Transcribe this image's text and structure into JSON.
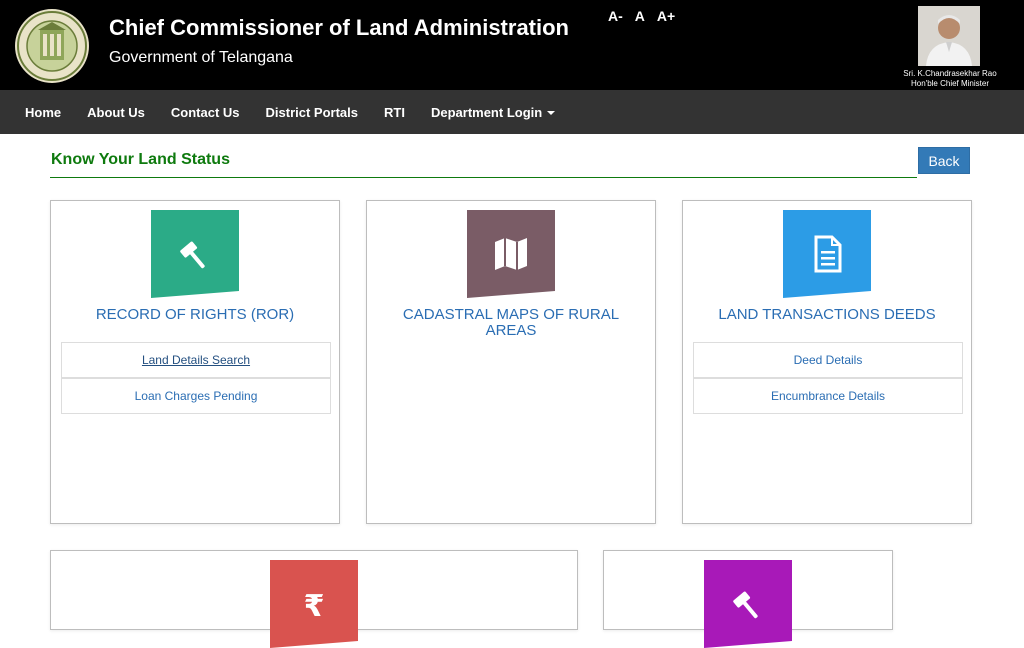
{
  "header": {
    "title": "Chief Commissioner of Land Administration",
    "subtitle": "Government of Telangana",
    "font_controls": [
      "A-",
      "A",
      "A+"
    ],
    "cm_name": "Sri. K.Chandrasekhar Rao",
    "cm_designation": "Hon'ble Chief Minister"
  },
  "nav": {
    "items": [
      "Home",
      "About Us",
      "Contact Us",
      "District Portals",
      "RTI",
      "Department Login"
    ]
  },
  "section": {
    "title": "Know Your Land Status",
    "back_label": "Back"
  },
  "cards": [
    {
      "title": "RECORD OF RIGHTS (ROR)",
      "icon": "gavel-icon",
      "color": "#2bab87",
      "links": [
        "Land Details Search",
        "Loan Charges Pending"
      ]
    },
    {
      "title": "CADASTRAL MAPS OF RURAL AREAS",
      "icon": "map-icon",
      "color": "#7a5c66",
      "links": []
    },
    {
      "title": "LAND TRANSACTIONS DEEDS",
      "icon": "document-icon",
      "color": "#2c9ce6",
      "links": [
        "Deed Details",
        "Encumbrance Details"
      ]
    },
    {
      "title": "",
      "icon": "rupee-icon",
      "color": "#d9534f",
      "links": []
    },
    {
      "title": "",
      "icon": "gavel-icon",
      "color": "#a819b8",
      "links": []
    }
  ],
  "colors": {
    "header_bg": "#000000",
    "nav_bg": "#333333",
    "section_green": "#0e7a0e",
    "link_blue": "#2a6db3",
    "button_blue": "#337ab7"
  }
}
